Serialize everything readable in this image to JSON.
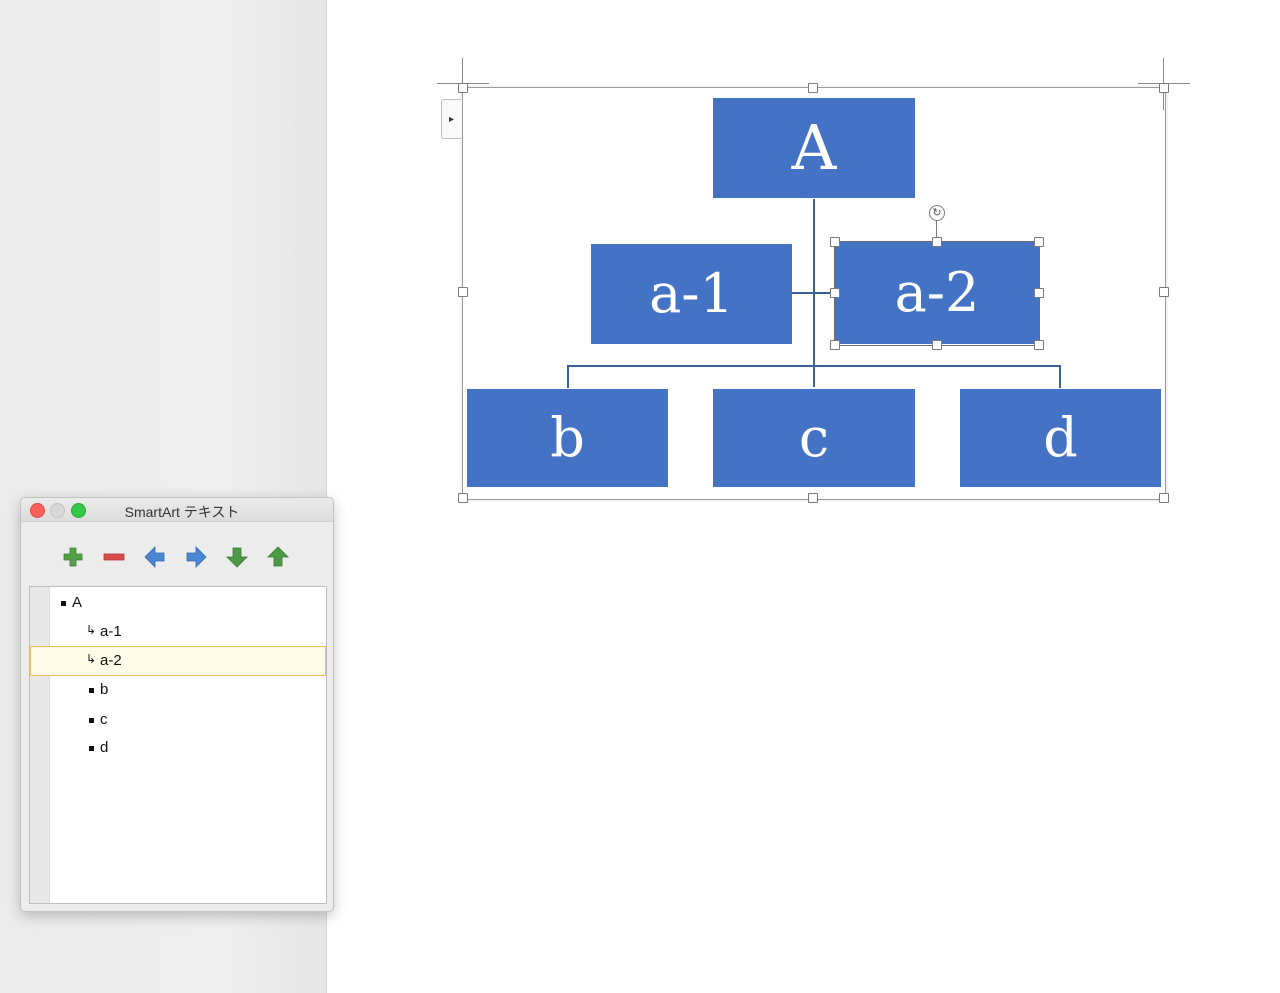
{
  "smartart_window": {
    "title": "SmartArt テキスト",
    "toolbar": [
      {
        "name": "add-item-button",
        "icon": "plus-icon",
        "color": "#54a04a"
      },
      {
        "name": "remove-item-button",
        "icon": "minus-icon",
        "color": "#d94c4c"
      },
      {
        "name": "promote-button",
        "icon": "arrow-left-icon",
        "color": "#4a86d2"
      },
      {
        "name": "demote-button",
        "icon": "arrow-right-icon",
        "color": "#4a86d2"
      },
      {
        "name": "move-down-button",
        "icon": "arrow-down-icon",
        "color": "#4e9a44"
      },
      {
        "name": "move-up-button",
        "icon": "arrow-up-icon",
        "color": "#4e9a44"
      }
    ],
    "items": [
      {
        "text": "A",
        "marker": "bullet"
      },
      {
        "text": "a-1",
        "marker": "assistant"
      },
      {
        "text": "a-2",
        "marker": "assistant",
        "selected": true
      },
      {
        "text": "b",
        "marker": "bullet"
      },
      {
        "text": "c",
        "marker": "bullet"
      },
      {
        "text": "d",
        "marker": "bullet"
      }
    ]
  },
  "diagram": {
    "fill_color": "#4472c4",
    "top": "A",
    "assistants": [
      "a-1",
      "a-2"
    ],
    "children": [
      "b",
      "c",
      "d"
    ],
    "selected_shape": "a-2"
  },
  "text_pane_toggle": "▸"
}
